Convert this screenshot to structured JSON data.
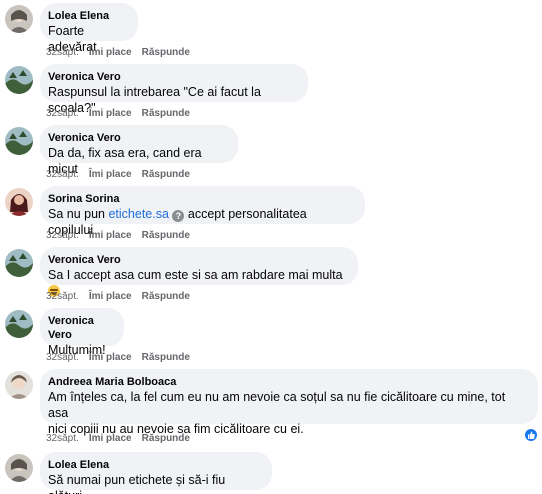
{
  "comments": [
    {
      "author": "Lolea Elena",
      "text_lines": [
        "Foarte adevărat"
      ],
      "time": "32săpt.",
      "like": "Îmi place",
      "reply": "Răspunde",
      "avatar_colors": [
        "#b8b3ad",
        "#6f6a66"
      ]
    },
    {
      "author": "Veronica Vero",
      "text_lines": [
        "Raspunsul la intrebarea \"Ce ai facut la scoala?\""
      ],
      "time": "32săpt.",
      "like": "Îmi place",
      "reply": "Răspunde",
      "avatar_colors": [
        "#8fb0b8",
        "#4d6b4a"
      ]
    },
    {
      "author": "Veronica Vero",
      "text_lines": [
        "Da da, fix asa era, cand era micut"
      ],
      "time": "32săpt.",
      "like": "Îmi place",
      "reply": "Răspunde",
      "avatar_colors": [
        "#8fb0b8",
        "#4d6b4a"
      ]
    },
    {
      "author": "Sorina Sorina",
      "text_before": "Sa nu pun ",
      "link": "etichete.sa",
      "text_after": " accept personalitatea copilului",
      "time": "32săpt.",
      "like": "Îmi place",
      "reply": "Răspunde",
      "avatar_colors": [
        "#e8c2b0",
        "#6b2a2a"
      ]
    },
    {
      "author": "Veronica Vero",
      "text_lines": [
        "Sa I accept asa cum este si sa am rabdare mai multa"
      ],
      "time": "32săpt.",
      "like": "Îmi place",
      "reply": "Răspunde",
      "avatar_colors": [
        "#8fb0b8",
        "#4d6b4a"
      ]
    },
    {
      "author": "Veronica Vero",
      "text_lines": [
        "Multumim!"
      ],
      "time": "32săpt.",
      "like": "Îmi place",
      "reply": "Răspunde",
      "avatar_colors": [
        "#8fb0b8",
        "#4d6b4a"
      ]
    },
    {
      "author": "Andreea Maria Bolboaca",
      "text_lines": [
        "Am înțeles ca, la fel cum eu nu am nevoie ca soțul sa nu fie cicălitoare cu mine, tot asa",
        "nici copiii nu au nevoie sa fim cicălitoare cu ei."
      ],
      "time": "32săpt.",
      "like": "Îmi place",
      "reply": "Răspunde",
      "avatar_colors": [
        "#d9d4cf",
        "#8a7a70"
      ]
    },
    {
      "author": "Lolea Elena",
      "text_lines": [
        "Să numai pun etichete și să-i fiu alături"
      ],
      "avatar_colors": [
        "#b8b3ad",
        "#6f6a66"
      ]
    }
  ],
  "icons": {
    "question": "?",
    "emoji": "laughing-emoji-icon",
    "like_badge": "thumbs-up-icon",
    "like_color": "#1877f2",
    "link_color": "#216fdb",
    "bubble_color": "#f0f2f5"
  }
}
